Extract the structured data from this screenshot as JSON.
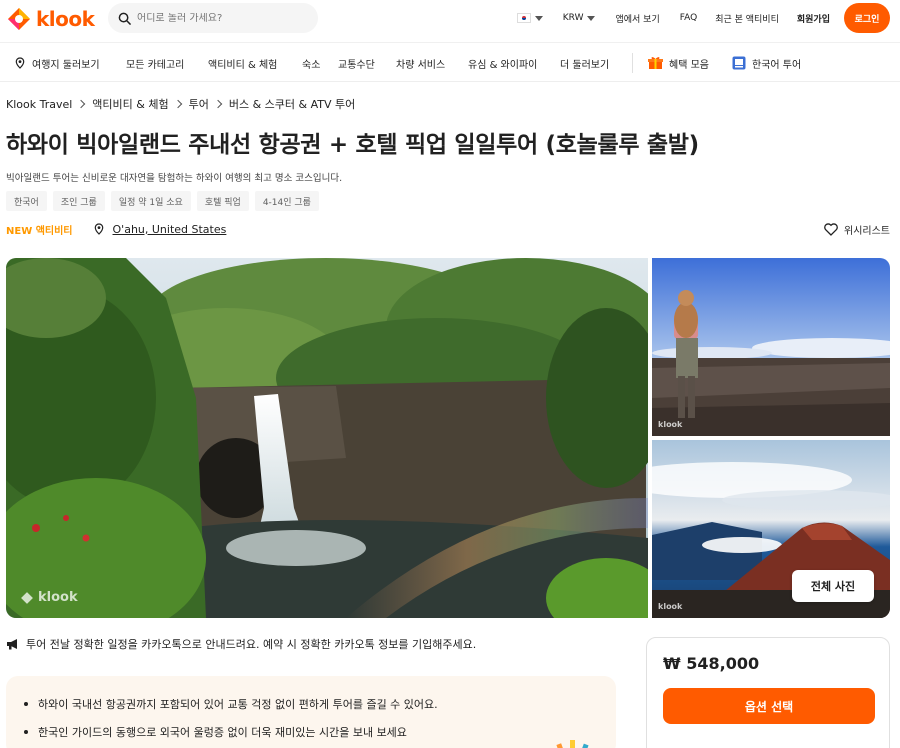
{
  "brand": {
    "name": "klook",
    "accent": "#ff5b00"
  },
  "header": {
    "search_placeholder": "어디로 놀러 가세요?",
    "currency": "KRW",
    "app_link": "앱에서 보기",
    "faq": "FAQ",
    "recent": "최근 본 액티비티",
    "signup": "회원가입",
    "login": "로그인"
  },
  "nav": {
    "items": [
      "여행지 둘러보기",
      "모든 카테고리",
      "액티비티 & 체험",
      "숙소",
      "교통수단",
      "차량 서비스",
      "유심 & 와이파이",
      "더 둘러보기"
    ],
    "promo": "혜택 모음",
    "korean_tour": "한국어 투어"
  },
  "breadcrumb": [
    "Klook Travel",
    "액티비티 & 체험",
    "투어",
    "버스 & 스쿠터 & ATV 투어"
  ],
  "product": {
    "title": "하와이 빅아일랜드 주내선 항공권 + 호텔 픽업 일일투어 (호놀룰루 출발)",
    "subtitle": "빅아일랜드 투어는 신비로운 대자연을 탐험하는 하와이 여행의 최고 명소 코스입니다.",
    "tags": [
      "한국어",
      "조인 그룹",
      "일정 약 1일 소요",
      "호텔 픽업",
      "4-14인 그룹"
    ],
    "new_label": "NEW 액티비티",
    "location": "O'ahu, United States",
    "wishlist": "위시리스트"
  },
  "gallery": {
    "all_photos": "전체 사진",
    "watermark": "klook"
  },
  "notice": "투어 전날 정확한 일정을 카카오톡으로 안내드려요. 예약 시 정확한 카카오톡 정보를 기입해주세요.",
  "highlights": [
    "하와이 국내선 항공권까지 포함되어 있어 교통 걱정 없이 편하게 투어를 즐길 수 있어요.",
    "한국인 가이드의 동행으로 외국어 울렁증 없이 더욱 재미있는 시간을 보내 보세요"
  ],
  "booking": {
    "price": "₩ 548,000",
    "select_label": "옵션 선택"
  }
}
